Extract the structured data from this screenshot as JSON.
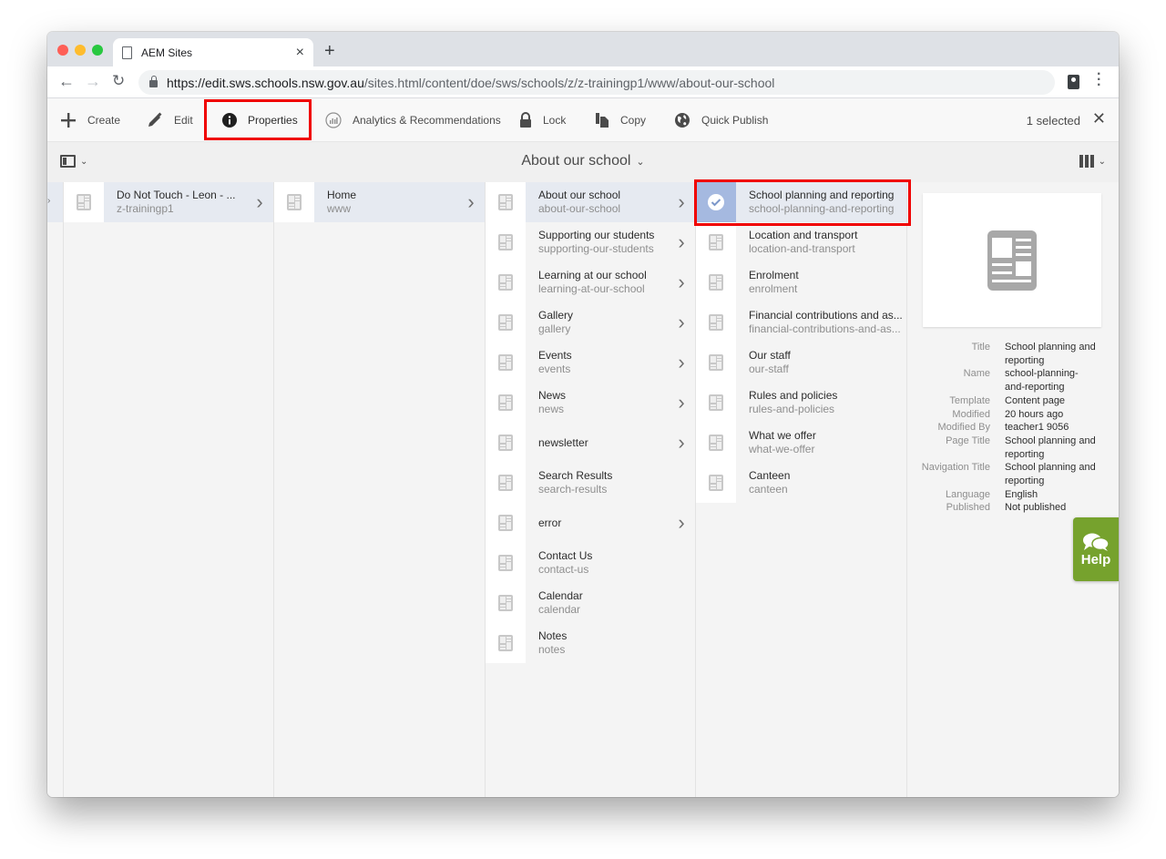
{
  "browser": {
    "tab_title": "AEM Sites",
    "url_host": "https://edit.sws.schools.nsw.gov.au",
    "url_path": "/sites.html/content/doe/sws/schools/z/z-trainingp1/www/about-our-school"
  },
  "actionbar": {
    "actions": [
      {
        "label": "Create",
        "icon": "plus-icon"
      },
      {
        "label": "Edit",
        "icon": "pencil-icon"
      },
      {
        "label": "Properties",
        "icon": "info-icon"
      },
      {
        "label": "Analytics & Recommendations",
        "icon": "analytics-icon"
      },
      {
        "label": "Lock",
        "icon": "lock-icon"
      },
      {
        "label": "Copy",
        "icon": "copy-icon"
      },
      {
        "label": "Quick Publish",
        "icon": "globe-icon"
      }
    ],
    "selected_count": "1 selected"
  },
  "titlebar": {
    "title": "About our school"
  },
  "columns": {
    "col1": [
      {
        "title": "Do Not Touch - Leon - ...",
        "name": "z-trainingp1",
        "has_children": true,
        "active": true
      }
    ],
    "col2": [
      {
        "title": "Home",
        "name": "www",
        "has_children": true,
        "active": true
      }
    ],
    "col3": [
      {
        "title": "About our school",
        "name": "about-our-school",
        "has_children": true,
        "active": true
      },
      {
        "title": "Supporting our students",
        "name": "supporting-our-students",
        "has_children": true
      },
      {
        "title": "Learning at our school",
        "name": "learning-at-our-school",
        "has_children": true
      },
      {
        "title": "Gallery",
        "name": "gallery",
        "has_children": true
      },
      {
        "title": "Events",
        "name": "events",
        "has_children": true
      },
      {
        "title": "News",
        "name": "news",
        "has_children": true
      },
      {
        "title": "newsletter",
        "name": "",
        "has_children": true
      },
      {
        "title": "Search Results",
        "name": "search-results",
        "has_children": false
      },
      {
        "title": "error",
        "name": "",
        "has_children": true
      },
      {
        "title": "Contact Us",
        "name": "contact-us",
        "has_children": false
      },
      {
        "title": "Calendar",
        "name": "calendar",
        "has_children": false
      },
      {
        "title": "Notes",
        "name": "notes",
        "has_children": false
      }
    ],
    "col4": [
      {
        "title": "School planning and reporting",
        "name": "school-planning-and-reporting",
        "selected": true
      },
      {
        "title": "Location and transport",
        "name": "location-and-transport"
      },
      {
        "title": "Enrolment",
        "name": "enrolment"
      },
      {
        "title": "Financial contributions and as...",
        "name": "financial-contributions-and-as..."
      },
      {
        "title": "Our staff",
        "name": "our-staff"
      },
      {
        "title": "Rules and policies",
        "name": "rules-and-policies"
      },
      {
        "title": "What we offer",
        "name": "what-we-offer"
      },
      {
        "title": "Canteen",
        "name": "canteen"
      }
    ]
  },
  "preview": {
    "meta": [
      {
        "label": "Title",
        "value": "School planning and reporting"
      },
      {
        "label": "Name",
        "value": "school-planning-and-reporting"
      },
      {
        "label": "Template",
        "value": "Content page"
      },
      {
        "label": "Modified",
        "value": "20 hours ago"
      },
      {
        "label": "Modified By",
        "value": "teacher1 9056"
      },
      {
        "label": "Page Title",
        "value": "School planning and reporting"
      },
      {
        "label": "Navigation Title",
        "value": "School planning and reporting"
      },
      {
        "label": "Language",
        "value": "English"
      },
      {
        "label": "Published",
        "value": "Not published"
      }
    ]
  },
  "help": {
    "label": "Help"
  },
  "colors": {
    "highlight": "#f00000",
    "help_green": "#76a22d",
    "selected_thumb": "#a5b9e0",
    "active_row": "#e6eaf1"
  }
}
